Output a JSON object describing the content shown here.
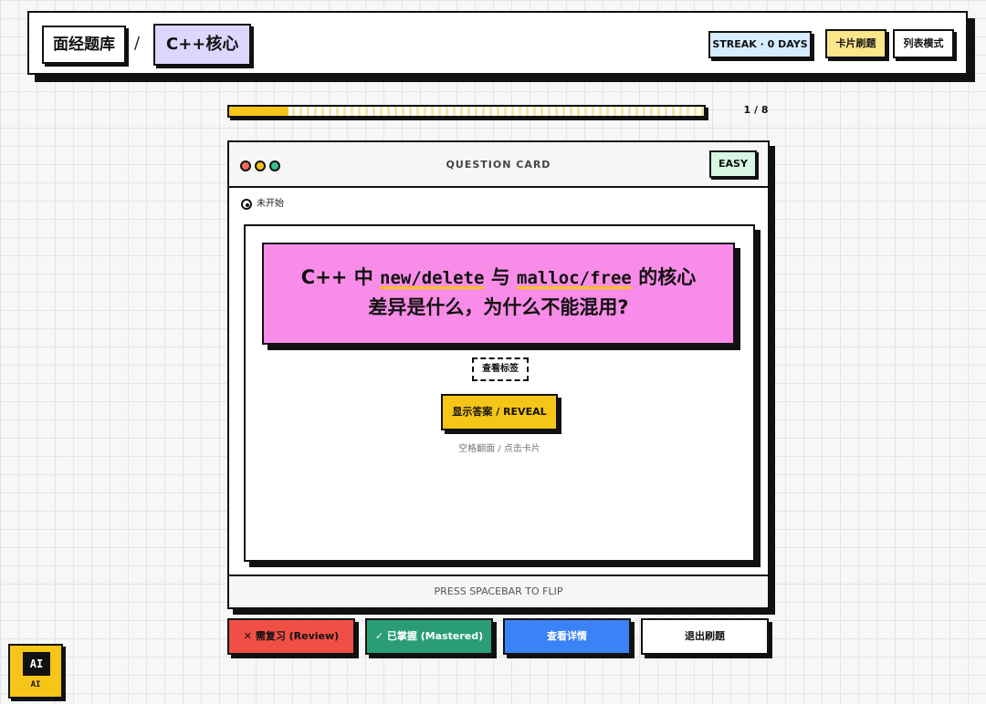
{
  "header": {
    "breadcrumb_root": "面经题库",
    "breadcrumb_separator": "/",
    "breadcrumb_current": "C++核心",
    "streak": "STREAK · 0 DAYS",
    "card_mode_label": "卡片刷题",
    "list_mode_label": "列表模式"
  },
  "progress": {
    "current": 1,
    "total": 8,
    "fraction": 0.125,
    "text": "1 / 8"
  },
  "card": {
    "title": "QUESTION CARD",
    "difficulty": "EASY",
    "status": "未开始",
    "question": {
      "line1_prefix": "C++ 中 ",
      "code1": "new/delete",
      "line1_mid": " 与 ",
      "code2": "malloc/free",
      "line1_suffix": " 的核心",
      "line2": "差异是什么，为什么不能混用?"
    },
    "tags_toggle": "查看标签",
    "reveal_button": "显示答案 / REVEAL",
    "hint": "空格翻面 / 点击卡片",
    "footer": "PRESS SPACEBAR TO FLIP"
  },
  "actions": {
    "review": "✕ 需复习 (Review)",
    "mastered": "✓ 已掌握 (Mastered)",
    "details": "查看详情",
    "exit": "退出刷题"
  },
  "ai_widget": {
    "icon_text": "AI",
    "label": "AI"
  },
  "colors": {
    "accent_yellow": "#f5c518",
    "question_pink": "#f98ce8",
    "review_red": "#ef4f45",
    "mastered_green": "#2a9d77",
    "details_blue": "#3b82f6",
    "breadcrumb_purple": "#ddd6ff",
    "streak_blue": "#d7ecff",
    "easy_green": "#d7f7e4"
  }
}
